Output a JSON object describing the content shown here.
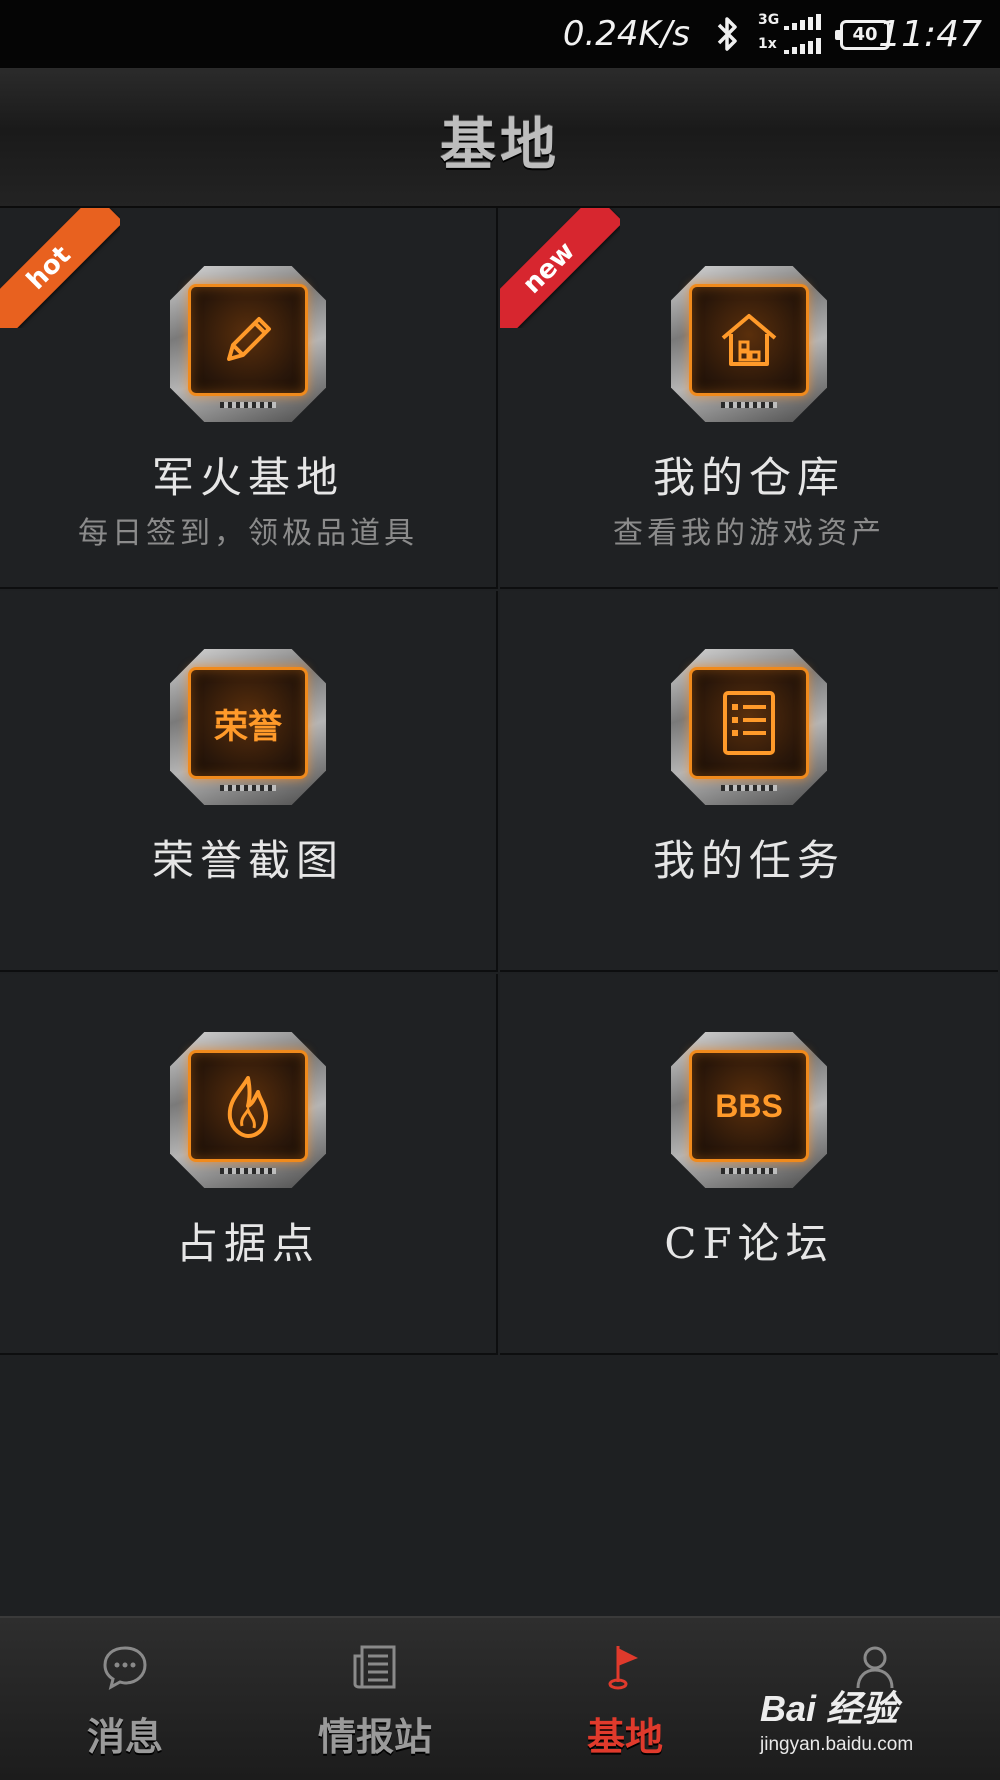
{
  "status_bar": {
    "speed": "0.24K/s",
    "network_top": "3G",
    "network_bottom": "1x",
    "battery": "40",
    "time": "11:47",
    "icons": [
      "bluetooth-icon",
      "signal-icon",
      "battery-icon"
    ]
  },
  "header": {
    "title": "基地"
  },
  "tiles": [
    {
      "title": "军火基地",
      "subtitle": "每日签到，领极品道具",
      "badge": "hot",
      "icon": "pencil-icon"
    },
    {
      "title": "我的仓库",
      "subtitle": "查看我的游戏资产",
      "badge": "new",
      "icon": "house-icon"
    },
    {
      "title": "荣誉截图",
      "subtitle": "",
      "badge": "",
      "icon": "honor-icon",
      "icon_text": "荣誉"
    },
    {
      "title": "我的任务",
      "subtitle": "",
      "badge": "",
      "icon": "list-icon"
    },
    {
      "title": "占据点",
      "subtitle": "",
      "badge": "",
      "icon": "flame-icon"
    },
    {
      "title": "CF论坛",
      "subtitle": "",
      "badge": "",
      "icon": "bbs-icon",
      "icon_text": "BBS"
    }
  ],
  "bottom_nav": [
    {
      "label": "消息",
      "icon": "chat-bubble-icon",
      "active": false
    },
    {
      "label": "情报站",
      "icon": "newspaper-icon",
      "active": false
    },
    {
      "label": "基地",
      "icon": "golf-flag-icon",
      "active": true
    },
    {
      "label": "",
      "icon": "person-icon",
      "active": false
    }
  ],
  "watermark": {
    "main": "Bai 经验",
    "url": "jingyan.baidu.com"
  },
  "colors": {
    "accent_active": "#e03a2c",
    "icon_glow": "#f08a1c",
    "hot_ribbon": "#e8611f",
    "new_ribbon": "#d7262f"
  }
}
